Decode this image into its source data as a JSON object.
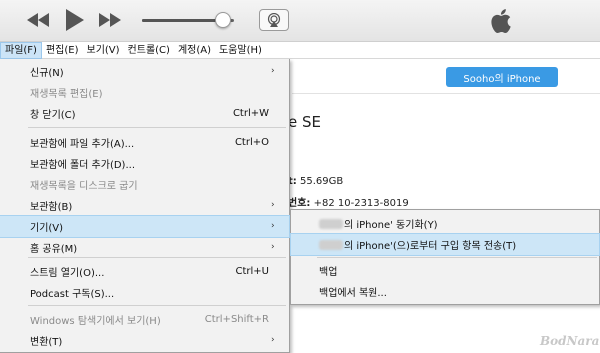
{
  "player": {
    "icons": [
      "rewind-icon",
      "play-icon",
      "fast-forward-icon",
      "airplay-icon",
      "apple-logo"
    ],
    "volume_fraction": 0.88
  },
  "menubar": [
    "파일(F)",
    "편집(E)",
    "보기(V)",
    "컨트롤(C)",
    "계정(A)",
    "도움말(H)"
  ],
  "device_button": "Sooho의 iPhone",
  "device_title": "e SE",
  "info": [
    {
      "label": "t:",
      "value": "55.69GB"
    },
    {
      "label": "번호:",
      "value": "+82 10-2313-8019"
    }
  ],
  "file_menu": [
    {
      "label": "신규(N)",
      "shortcut": "",
      "arrow": "›",
      "disabled": false
    },
    {
      "label": "재생목록 편집(E)",
      "shortcut": "",
      "arrow": "",
      "disabled": true
    },
    {
      "label": "창 닫기(C)",
      "shortcut": "Ctrl+W",
      "arrow": "",
      "disabled": false
    },
    {
      "label": "보관함에 파일 추가(A)...",
      "shortcut": "Ctrl+O",
      "arrow": "",
      "disabled": false
    },
    {
      "label": "보관함에 폴더 추가(D)...",
      "shortcut": "",
      "arrow": "",
      "disabled": false
    },
    {
      "label": "재생목록을 디스크로 굽기",
      "shortcut": "",
      "arrow": "",
      "disabled": true
    },
    {
      "label": "보관함(B)",
      "shortcut": "",
      "arrow": "›",
      "disabled": false
    },
    {
      "label": "기기(V)",
      "shortcut": "",
      "arrow": "›",
      "disabled": false,
      "highlight": true
    },
    {
      "label": "홈 공유(M)",
      "shortcut": "",
      "arrow": "›",
      "disabled": false
    },
    {
      "label": "스트림 열기(O)...",
      "shortcut": "Ctrl+U",
      "arrow": "",
      "disabled": false
    },
    {
      "label": "Podcast 구독(S)...",
      "shortcut": "",
      "arrow": "",
      "disabled": false
    },
    {
      "label": "Windows 탐색기에서 보기(H)",
      "shortcut": "Ctrl+Shift+R",
      "arrow": "",
      "disabled": true
    },
    {
      "label": "변환(T)",
      "shortcut": "",
      "arrow": "›",
      "disabled": false
    }
  ],
  "device_submenu": [
    {
      "label": "의 iPhone' 동기화(Y)",
      "redacted_prefix": true
    },
    {
      "label": "의 iPhone'(으)로부터 구입 항목 전송(T)",
      "redacted_prefix": true,
      "highlight": true
    },
    {
      "label": "백업",
      "redacted_prefix": false
    },
    {
      "label": "백업에서 복원...",
      "redacted_prefix": false
    }
  ],
  "watermark": "BodNara"
}
